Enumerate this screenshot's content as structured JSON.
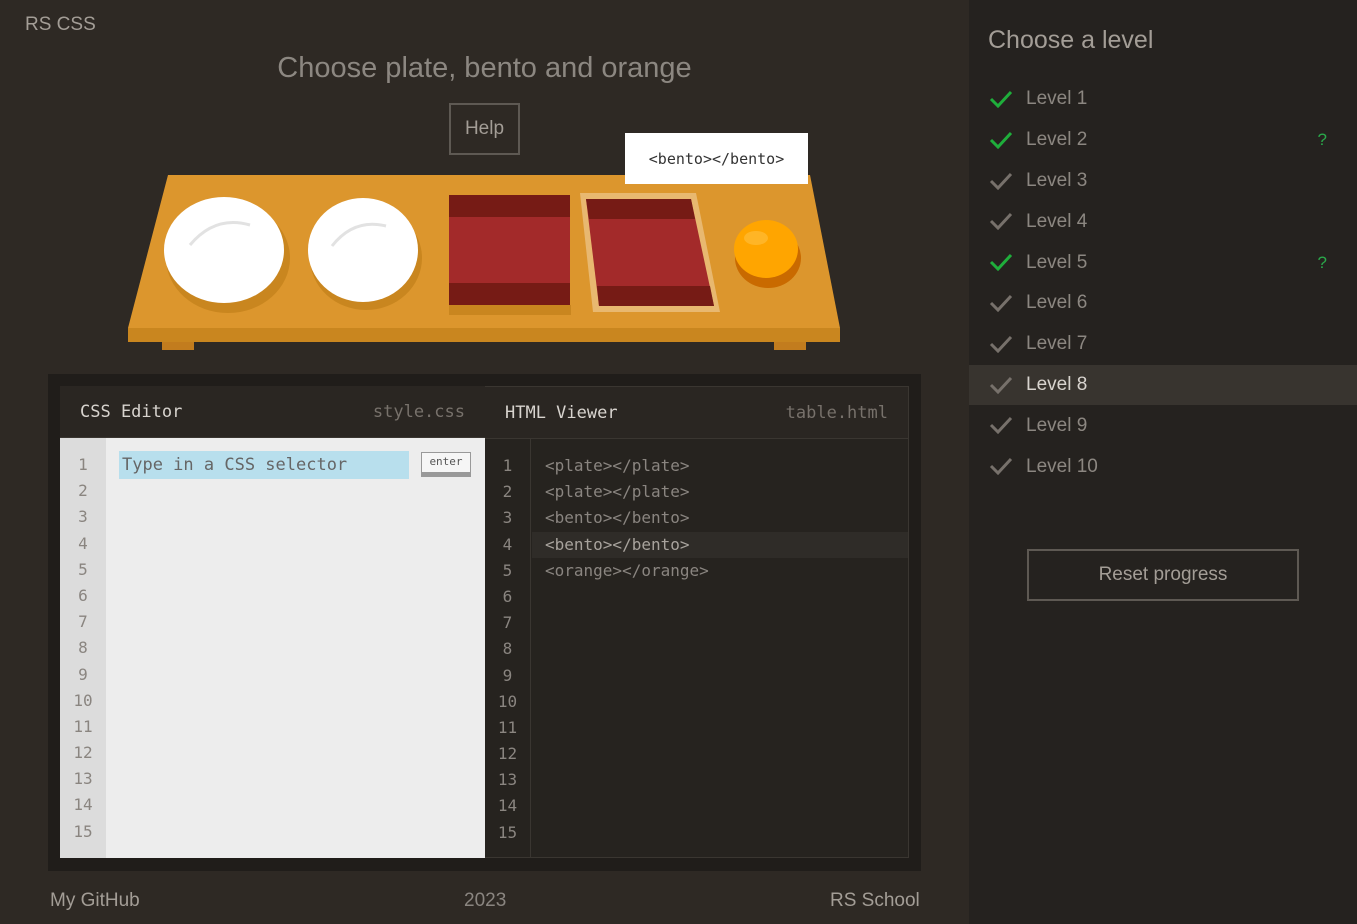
{
  "app": {
    "logo": "RS CSS"
  },
  "task": {
    "title": "Choose plate, bento and orange",
    "help_label": "Help"
  },
  "tooltip": {
    "text": "<bento></bento>"
  },
  "css_editor": {
    "title": "CSS Editor",
    "file": "style.css",
    "placeholder": "Type in a CSS selector",
    "enter_label": "enter",
    "line_numbers": [
      "1",
      "2",
      "3",
      "4",
      "5",
      "6",
      "7",
      "8",
      "9",
      "10",
      "11",
      "12",
      "13",
      "14",
      "15"
    ]
  },
  "html_viewer": {
    "title": "HTML Viewer",
    "file": "table.html",
    "line_numbers": [
      "1",
      "2",
      "3",
      "4",
      "5",
      "6",
      "7",
      "8",
      "9",
      "10",
      "11",
      "12",
      "13",
      "14",
      "15"
    ],
    "lines": [
      "<plate></plate>",
      "<plate></plate>",
      "<bento></bento>",
      "<bento></bento>",
      "<orange></orange>"
    ],
    "active_line": 4
  },
  "footer": {
    "github": "My GitHub",
    "year": "2023",
    "school": "RS School"
  },
  "sidebar": {
    "title": "Choose a level",
    "levels": [
      {
        "label": "Level 1",
        "completed": true,
        "help": ""
      },
      {
        "label": "Level 2",
        "completed": true,
        "help": "?"
      },
      {
        "label": "Level 3",
        "completed": false,
        "help": ""
      },
      {
        "label": "Level 4",
        "completed": false,
        "help": ""
      },
      {
        "label": "Level 5",
        "completed": true,
        "help": "?"
      },
      {
        "label": "Level 6",
        "completed": false,
        "help": ""
      },
      {
        "label": "Level 7",
        "completed": false,
        "help": ""
      },
      {
        "label": "Level 8",
        "completed": false,
        "help": "",
        "active": true
      },
      {
        "label": "Level 9",
        "completed": false,
        "help": ""
      },
      {
        "label": "Level 10",
        "completed": false,
        "help": ""
      }
    ],
    "reset_label": "Reset progress"
  },
  "colors": {
    "check_completed": "#1fae3b",
    "check_default": "#77716b",
    "table_wood": "#dc962d",
    "bento_red": "#a32a2a",
    "orange": "#ffa500",
    "highlight": "#e8b870"
  },
  "icons": {
    "check": "check-icon"
  }
}
